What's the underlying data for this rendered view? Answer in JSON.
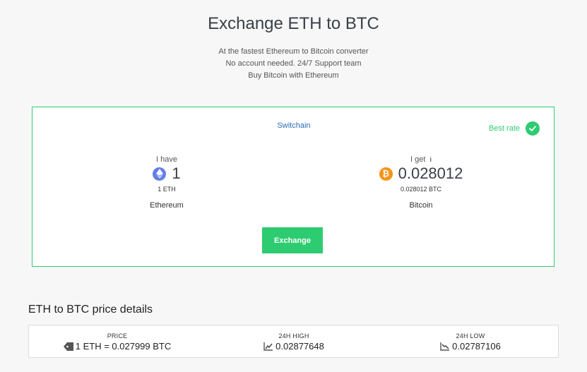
{
  "header": {
    "title": "Exchange ETH to BTC",
    "subtitle_lines": [
      "At the fastest Ethereum to Bitcoin converter",
      "No account needed. 24/7 Support team",
      "Buy Bitcoin with Ethereum"
    ]
  },
  "exchange_card": {
    "switch_label": "Switchain",
    "best_rate_label": "Best rate",
    "from": {
      "label": "I have",
      "amount": "1",
      "sub": "1 ETH",
      "currency_name": "Ethereum",
      "icon": "ethereum-icon"
    },
    "to": {
      "label": "I get",
      "info_glyph": "i",
      "amount": "0.028012",
      "sub": "0.028012 BTC",
      "currency_name": "Bitcoin",
      "icon": "bitcoin-icon",
      "icon_glyph": "₿"
    },
    "exchange_button": "Exchange"
  },
  "price_details": {
    "title": "ETH to BTC price details",
    "price": {
      "header": "PRICE",
      "value": "1 ETH = 0.027999 BTC",
      "icon": "tag-icon"
    },
    "high": {
      "header": "24H HIGH",
      "value": "0.02877648",
      "icon": "trend-up-icon"
    },
    "low": {
      "header": "24H LOW",
      "value": "0.02787106",
      "icon": "trend-down-icon"
    }
  },
  "colors": {
    "accent": "#2ecc71",
    "link": "#2a6db5",
    "eth": "#627eea",
    "btc": "#f7931a"
  }
}
